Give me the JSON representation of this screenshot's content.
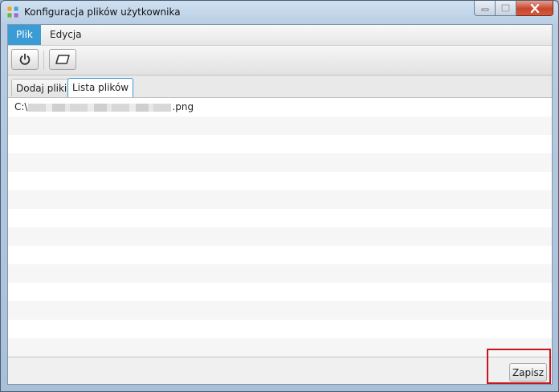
{
  "window": {
    "title": "Konfiguracja plików użytkownika",
    "app_icon": "app-grid-icon",
    "controls": [
      "minimize-icon",
      "maximize-icon",
      "close-icon"
    ]
  },
  "menubar": {
    "items": [
      {
        "label": "Plik",
        "active": true
      },
      {
        "label": "Edycja",
        "active": false
      }
    ]
  },
  "toolbar": {
    "buttons": [
      {
        "icon": "power-icon"
      },
      {
        "icon": "eraser-icon"
      }
    ]
  },
  "tabs": [
    {
      "label": "Dodaj pliki",
      "selected": false
    },
    {
      "label": "Lista plików",
      "selected": true
    }
  ],
  "file_list": {
    "items": [
      {
        "prefix": "C:\\",
        "suffix": ".png"
      }
    ]
  },
  "footer": {
    "save_label": "Zapisz"
  },
  "colors": {
    "accent": "#3b9bd4",
    "highlight": "#c4161c"
  }
}
